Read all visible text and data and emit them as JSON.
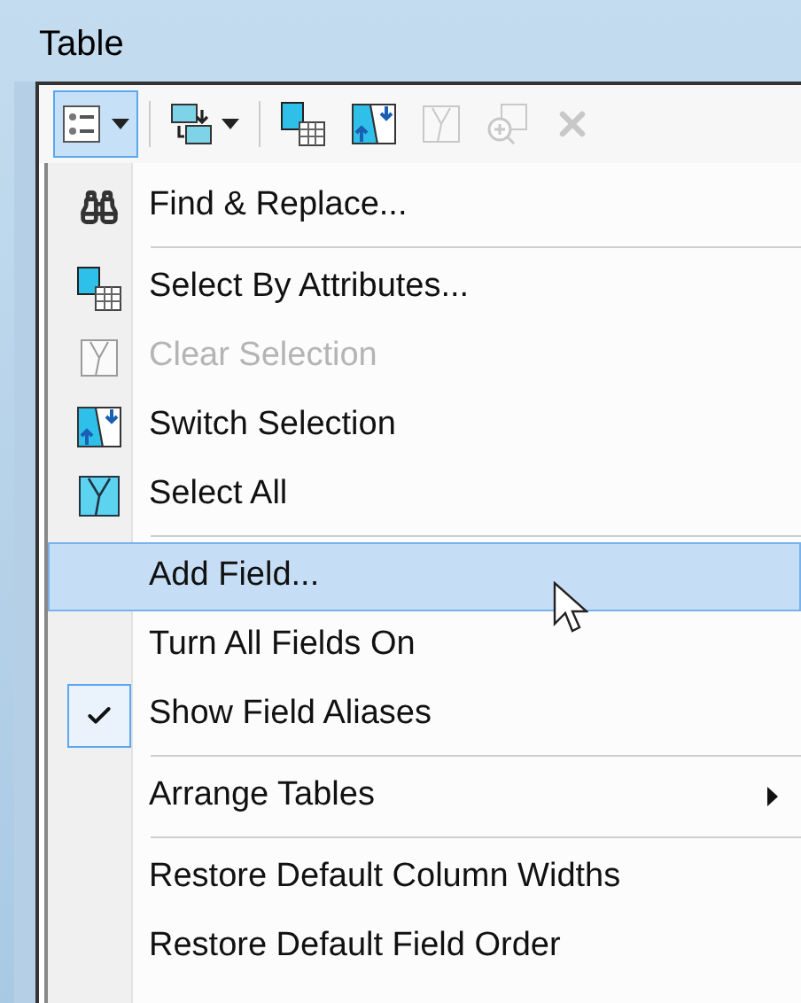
{
  "window": {
    "title": "Table"
  },
  "toolbar": {
    "buttons": [
      {
        "kind": "table-options",
        "pressed": true,
        "dropdown": true,
        "disabled": false
      },
      {
        "kind": "related-tables",
        "pressed": false,
        "dropdown": true,
        "disabled": false
      },
      {
        "kind": "select-by-attributes",
        "pressed": false,
        "dropdown": false,
        "disabled": false
      },
      {
        "kind": "switch-selection",
        "pressed": false,
        "dropdown": false,
        "disabled": false
      },
      {
        "kind": "clear-selection",
        "pressed": false,
        "dropdown": false,
        "disabled": true
      },
      {
        "kind": "zoom-selected",
        "pressed": false,
        "dropdown": false,
        "disabled": true
      },
      {
        "kind": "delete",
        "pressed": false,
        "dropdown": false,
        "disabled": true
      }
    ]
  },
  "menu": {
    "items": [
      {
        "kind": "find",
        "label": "Find & Replace...",
        "disabled": false,
        "highlighted": false,
        "checked": false,
        "submenu": false
      },
      {
        "kind": "separator"
      },
      {
        "kind": "select-by-attributes",
        "label": "Select By Attributes...",
        "disabled": false,
        "highlighted": false,
        "checked": false,
        "submenu": false
      },
      {
        "kind": "clear-selection",
        "label": "Clear Selection",
        "disabled": true,
        "highlighted": false,
        "checked": false,
        "submenu": false
      },
      {
        "kind": "switch-selection",
        "label": "Switch Selection",
        "disabled": false,
        "highlighted": false,
        "checked": false,
        "submenu": false
      },
      {
        "kind": "select-all",
        "label": "Select All",
        "disabled": false,
        "highlighted": false,
        "checked": false,
        "submenu": false
      },
      {
        "kind": "separator"
      },
      {
        "kind": "plain",
        "label": "Add Field...",
        "disabled": false,
        "highlighted": true,
        "checked": false,
        "submenu": false
      },
      {
        "kind": "plain",
        "label": "Turn All Fields On",
        "disabled": false,
        "highlighted": false,
        "checked": false,
        "submenu": false
      },
      {
        "kind": "plain",
        "label": "Show Field Aliases",
        "disabled": false,
        "highlighted": false,
        "checked": true,
        "submenu": false
      },
      {
        "kind": "separator"
      },
      {
        "kind": "plain",
        "label": "Arrange Tables",
        "disabled": false,
        "highlighted": false,
        "checked": false,
        "submenu": true
      },
      {
        "kind": "separator"
      },
      {
        "kind": "plain",
        "label": "Restore Default Column Widths",
        "disabled": false,
        "highlighted": false,
        "checked": false,
        "submenu": false
      },
      {
        "kind": "plain",
        "label": "Restore Default Field Order",
        "disabled": false,
        "highlighted": false,
        "checked": false,
        "submenu": false
      }
    ]
  }
}
